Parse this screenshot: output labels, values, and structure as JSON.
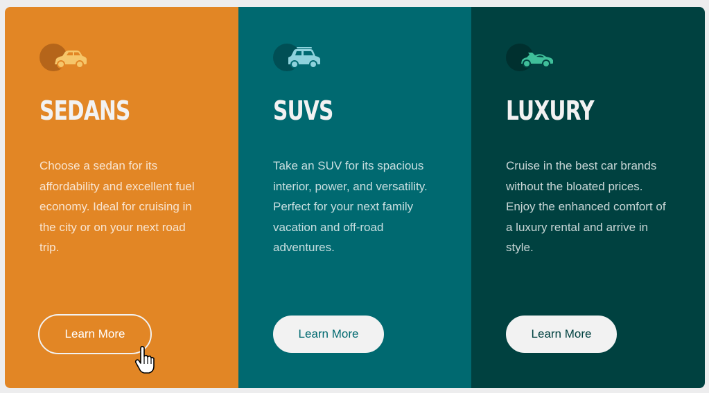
{
  "colors": {
    "sedans_bg": "#e28625",
    "suvs_bg": "#006970",
    "luxury_bg": "#004140",
    "light": "#f2f2f2"
  },
  "cards": [
    {
      "id": "sedans",
      "icon": "sedan-car-icon",
      "title": "SEDANS",
      "description": "Choose a sedan for its affordability and excellent fuel economy. Ideal for cruising in the city or on your next road trip.",
      "button_label": "Learn More"
    },
    {
      "id": "suvs",
      "icon": "suv-car-icon",
      "title": "SUVS",
      "description": "Take an SUV for its spacious interior, power, and versatility. Perfect for your next family vacation and off-road adventures.",
      "button_label": "Learn More"
    },
    {
      "id": "luxury",
      "icon": "luxury-car-icon",
      "title": "LUXURY",
      "description": "Cruise in the best car brands without the bloated prices. Enjoy the enhanced comfort of a luxury rental and arrive in style.",
      "button_label": "Learn More"
    }
  ],
  "cursor": "hand-pointer-icon"
}
